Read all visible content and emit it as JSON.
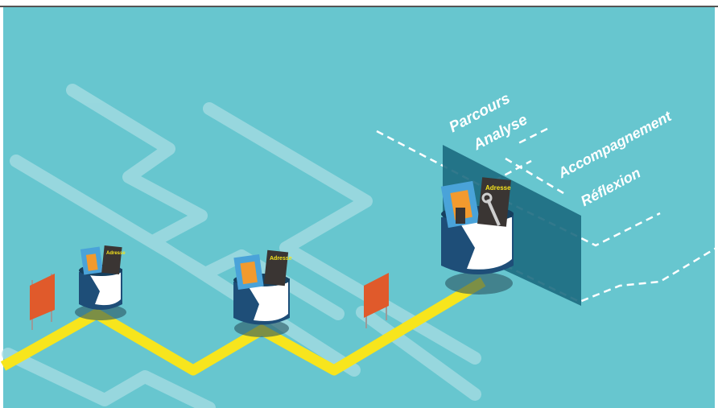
{
  "labels": {
    "parcours": "Parcours",
    "analyse": "Analyse",
    "accompagnement": "Accompagnement",
    "reflexion": "Réflexion"
  },
  "book_tag": "Adresse",
  "colors": {
    "background": "#67c6cf",
    "path_faint": "#a8dde3",
    "path_main": "#f7e51d",
    "head": "#1e4e78",
    "face": "#ffffff",
    "flag": "#e05a2b",
    "panel": "#1c6a80",
    "book_blue": "#4aa3d9",
    "book_orange": "#f29a2e",
    "book_dark": "#3a3533",
    "dashes": "#ffffff"
  },
  "icons": [
    "head-icon",
    "book-icon",
    "flag-icon",
    "wrench-icon"
  ]
}
